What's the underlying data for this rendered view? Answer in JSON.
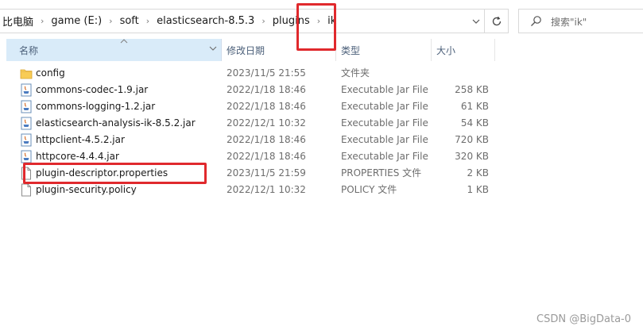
{
  "address_bar": {
    "crumbs": [
      "比电脑",
      "game (E:)",
      "soft",
      "elasticsearch-8.5.3",
      "plugins",
      "ik"
    ],
    "separator": "›"
  },
  "search": {
    "placeholder": "搜索\"ik\""
  },
  "columns": {
    "name": "名称",
    "date": "修改日期",
    "type": "类型",
    "size": "大小"
  },
  "files": [
    {
      "name": "config",
      "date": "2023/11/5 21:55",
      "type": "文件夹",
      "size": "",
      "icon": "folder-icon"
    },
    {
      "name": "commons-codec-1.9.jar",
      "date": "2022/1/18 18:46",
      "type": "Executable Jar File",
      "size": "258 KB",
      "icon": "jar-file-icon"
    },
    {
      "name": "commons-logging-1.2.jar",
      "date": "2022/1/18 18:46",
      "type": "Executable Jar File",
      "size": "61 KB",
      "icon": "jar-file-icon"
    },
    {
      "name": "elasticsearch-analysis-ik-8.5.2.jar",
      "date": "2022/12/1 10:32",
      "type": "Executable Jar File",
      "size": "54 KB",
      "icon": "jar-file-icon"
    },
    {
      "name": "httpclient-4.5.2.jar",
      "date": "2022/1/18 18:46",
      "type": "Executable Jar File",
      "size": "720 KB",
      "icon": "jar-file-icon"
    },
    {
      "name": "httpcore-4.4.4.jar",
      "date": "2022/1/18 18:46",
      "type": "Executable Jar File",
      "size": "320 KB",
      "icon": "jar-file-icon"
    },
    {
      "name": "plugin-descriptor.properties",
      "date": "2023/11/5 21:59",
      "type": "PROPERTIES 文件",
      "size": "2 KB",
      "icon": "document-icon"
    },
    {
      "name": "plugin-security.policy",
      "date": "2022/12/1 10:32",
      "type": "POLICY 文件",
      "size": "1 KB",
      "icon": "document-icon"
    }
  ],
  "watermark": "CSDN @BigData-0",
  "colors": {
    "header_selected": "#d9ebf9",
    "header_text": "#4c607a",
    "annotation": "#e0292d"
  }
}
